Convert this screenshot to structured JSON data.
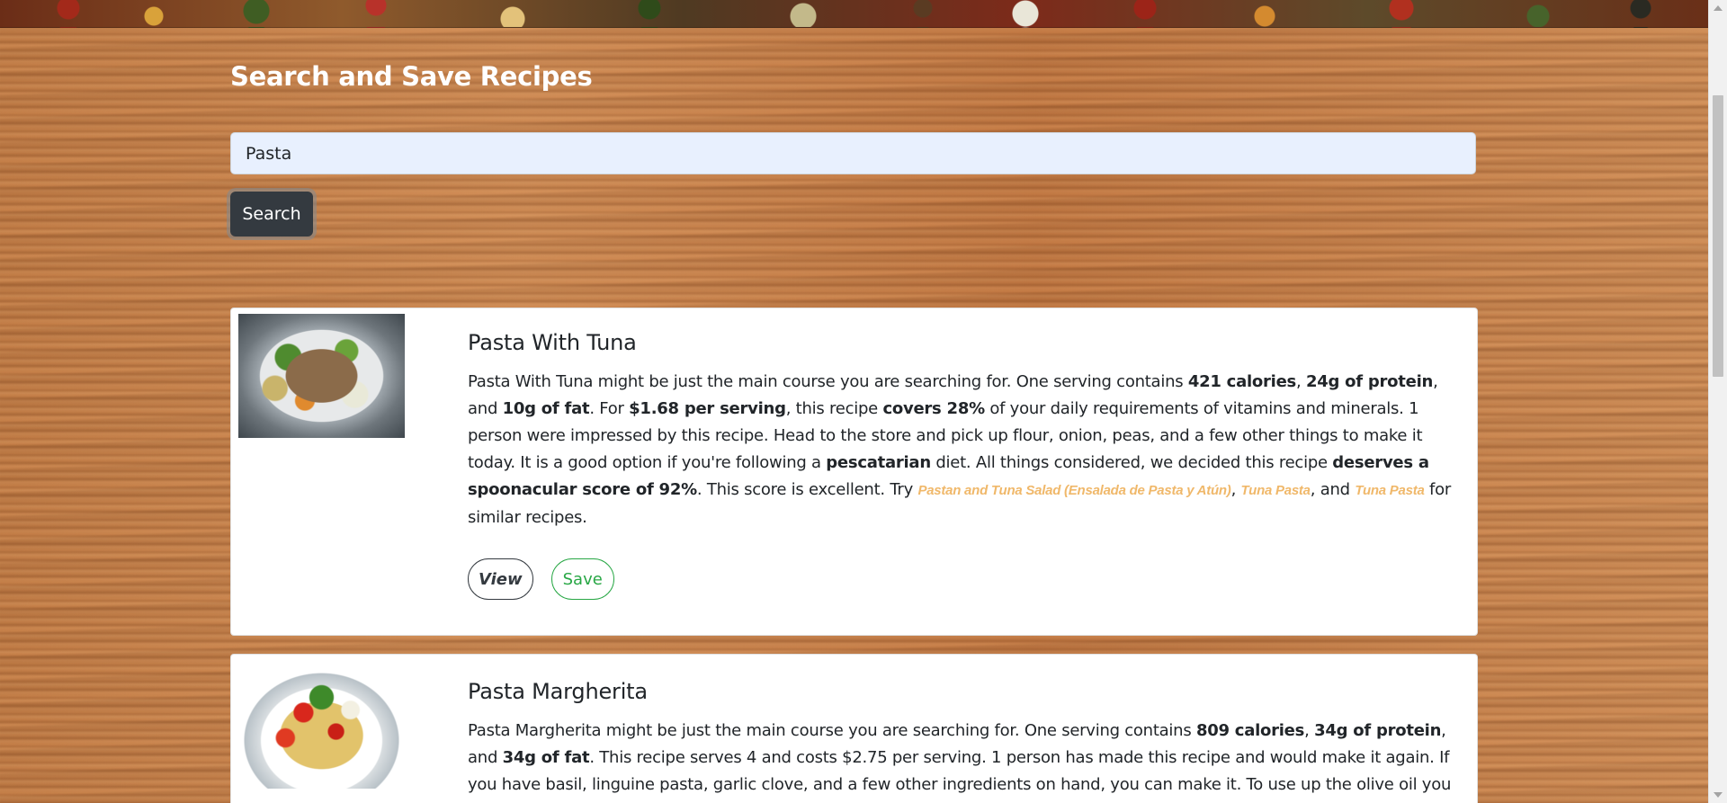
{
  "header": {
    "title": "Search and Save Recipes"
  },
  "search": {
    "value": "Pasta",
    "button_label": "Search"
  },
  "recipes": [
    {
      "title": "Pasta With Tuna",
      "summary": {
        "t1": "Pasta With Tuna might be just the main course you are searching for. One serving contains ",
        "b1": "421 calories",
        "t2": ", ",
        "b2": "24g of protein",
        "t3": ", and ",
        "b3": "10g of fat",
        "t4": ". For ",
        "b4": "$1.68 per serving",
        "t5": ", this recipe ",
        "b5": "covers 28%",
        "t6": " of your daily requirements of vitamins and minerals. 1 person were impressed by this recipe. Head to the store and pick up flour, onion, peas, and a few other things to make it today. It is a good option if you're following a ",
        "b6": "pescatarian",
        "t7": " diet. All things considered, we decided this recipe ",
        "b7": "deserves a spoonacular score of 92%",
        "t8": ". This score is excellent. Try ",
        "l1": "Pastan and Tuna Salad (Ensalada de Pasta y Atún)",
        "t9": ", ",
        "l2": "Tuna Pasta",
        "t10": ", and ",
        "l3": "Tuna Pasta",
        "t11": " for similar recipes."
      },
      "view_label": "View",
      "save_label": "Save"
    },
    {
      "title": "Pasta Margherita",
      "summary": {
        "t1": "Pasta Margherita might be just the main course you are searching for. One serving contains ",
        "b1": "809 calories",
        "t2": ", ",
        "b2": "34g of protein",
        "t3": ", and ",
        "b3": "34g of fat",
        "t4": ". This recipe serves 4 and costs $2.75 per serving. 1 person has made this recipe and would make it again. If you have basil, linguine pasta, garlic clove, and a few other ingredients on hand, you can make it. To use up the olive oil you"
      }
    }
  ]
}
